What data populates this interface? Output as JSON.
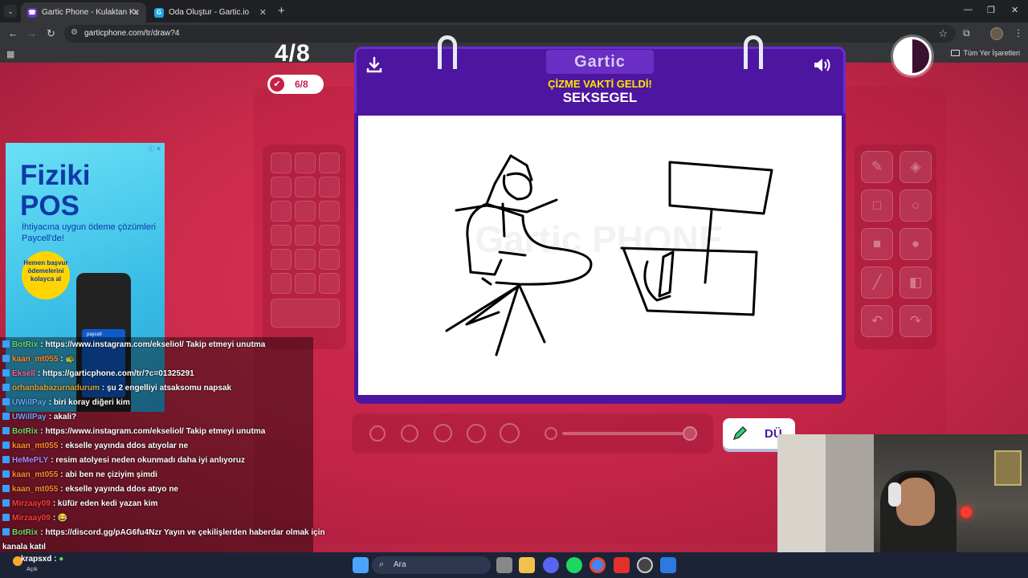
{
  "browser": {
    "tabs": [
      {
        "title": "Gartic Phone - Kulaktan Kulağa",
        "active": true,
        "favicon_color": "#6e2fd1"
      },
      {
        "title": "Oda Oluştur - Gartic.io",
        "active": false,
        "favicon_color": "#1ea7e1"
      }
    ],
    "url": "garticphone.com/tr/draw?4",
    "bookmarks_label": "Tüm Yer İşaretleri"
  },
  "game": {
    "round": "4/8",
    "done_count": "6/8",
    "logo": "Gartic",
    "subtitle": "ÇİZME VAKTİ GELDİ!",
    "word": "SEKSEGEL",
    "done_button": "DÜ",
    "canvas_watermark": "Gartic PHONE"
  },
  "ad": {
    "title_line1": "Fiziki",
    "title_line2": "POS",
    "desc": "İhtiyacına uygun ödeme çözümleri Paycell'de!",
    "badge": "Hemen başvur ödemelerini kolayca al",
    "logo": "paycell",
    "device_label": "paycell"
  },
  "chat": {
    "messages": [
      {
        "user": "BotRix",
        "user_color": "#6cd86c",
        "text": "https://www.instagram.com/ekseliol/ Takip etmeyi unutma"
      },
      {
        "user": "kaan_mt055",
        "user_color": "#ff8a2a",
        "text": "🐢"
      },
      {
        "user": "Eksell",
        "user_color": "#ff5fa0",
        "text": "https://garticphone.com/tr/?c=01325291"
      },
      {
        "user": "orhanbabazurnadurum",
        "user_color": "#d9a33a",
        "text": "şu 2 engelliyi atsaksomu napsak"
      },
      {
        "user": "UWillPay",
        "user_color": "#6aa6ff",
        "text": "biri koray diğeri kim"
      },
      {
        "user": "UWillPay",
        "user_color": "#6aa6ff",
        "text": "akali?"
      },
      {
        "user": "BotRix",
        "user_color": "#6cd86c",
        "text": "https://www.instagram.com/ekseliol/ Takip etmeyi unutma"
      },
      {
        "user": "kaan_mt055",
        "user_color": "#ff8a2a",
        "text": "ekselle yayında ddos atıyolar ne"
      },
      {
        "user": "HeMePLY",
        "user_color": "#a68aff",
        "text": "resim atolyesi neden okunmadı daha iyi anlıyoruz"
      },
      {
        "user": "kaan_mt055",
        "user_color": "#ff8a2a",
        "text": "abi ben ne çiziyim şimdi"
      },
      {
        "user": "kaan_mt055",
        "user_color": "#ff8a2a",
        "text": "ekselle yayında ddos atıyo ne"
      },
      {
        "user": "Mirzaay09",
        "user_color": "#ff3a3a",
        "text": "küfür eden kedi yazan kim"
      },
      {
        "user": "Mirzaay09",
        "user_color": "#ff3a3a",
        "text": "😂"
      },
      {
        "user": "BotRix",
        "user_color": "#6cd86c",
        "text": "https://discord.gg/pAG6fu4Nzr Yayın ve çekilişlerden haberdar olmak için"
      },
      {
        "user": "",
        "user_color": "#ffffff",
        "text": "kanala katıl"
      }
    ]
  },
  "taskbar": {
    "search_label": "Ara",
    "chat_user": "krapsxd",
    "weather": "Açık"
  }
}
